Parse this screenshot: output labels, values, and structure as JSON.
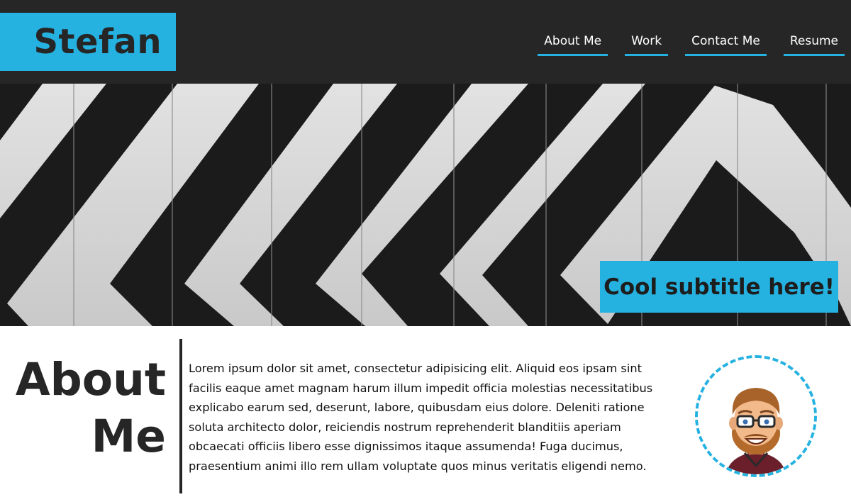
{
  "header": {
    "logo_text": "Stefan",
    "nav": [
      {
        "label": "About Me"
      },
      {
        "label": "Work"
      },
      {
        "label": "Contact Me"
      },
      {
        "label": "Resume"
      }
    ]
  },
  "hero": {
    "subtitle": "Cool subtitle here!"
  },
  "about": {
    "title_line1": "About",
    "title_line2": "Me",
    "body": "Lorem ipsum dolor sit amet, consectetur adipisicing elit. Aliquid eos ipsam sint facilis eaque amet magnam harum illum impedit officia molestias necessitatibus explicabo earum sed, deserunt, labore, quibusdam eius dolore. Deleniti ratione soluta architecto dolor, reiciendis nostrum reprehenderit blanditiis aperiam obcaecati officiis libero esse dignissimos itaque assumenda! Fuga ducimus, praesentium animi illo rem ullam voluptate quos minus veritatis eligendi nemo."
  },
  "colors": {
    "accent": "#25b2e1",
    "header_bg": "#262626",
    "text": "#262626"
  }
}
